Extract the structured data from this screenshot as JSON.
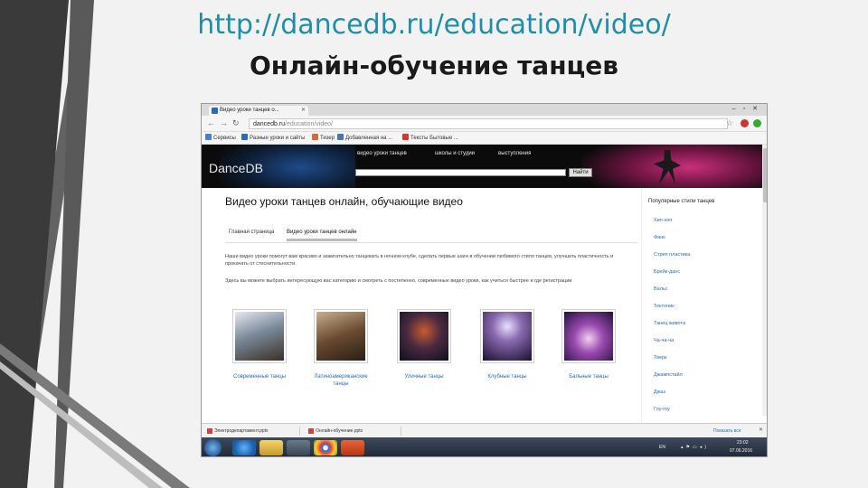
{
  "slide": {
    "url": "http://dancedb.ru/education/video/",
    "title": "Онлайн-обучение танцев"
  },
  "browser": {
    "tab_title": "Видео уроки танцев о...",
    "url_host": "dancedb.ru",
    "url_path": "/education/video/",
    "bookmarks": [
      "Сервисы",
      "Разные уроки и сайты",
      "Тизер",
      "Добавленная на ...",
      "Тексты Бытовые ..."
    ]
  },
  "site": {
    "logo": "DanceDB",
    "nav": [
      "видео уроки танцев",
      "школы и студии",
      "выступления"
    ],
    "search_button": "Найти"
  },
  "main": {
    "heading": "Видео уроки танцев онлайн, обучающие видео",
    "tabs": [
      "Главная страница",
      "Видео уроки танцев онлайн"
    ],
    "paragraph1": "Наши видео уроки помогут вам красиво и зажигательно танцевать в ночном клубе, сделать первые шаги в обучении любимого стиля танцев, улучшить пластичность и прокачать от стеснительности.",
    "paragraph2": "Здесь вы можете выбрать интересующую вас категорию и смотреть с постепенно, современные видео уроки, как учиться быстрее и где регистрации",
    "categories": [
      {
        "label": "Современные танцы"
      },
      {
        "label": "Латиноамериканские танцы"
      },
      {
        "label": "Уличные танцы"
      },
      {
        "label": "Клубные танцы"
      },
      {
        "label": "Бальные танцы"
      }
    ]
  },
  "sidebar": {
    "title": "Популярные стили танцев",
    "items": [
      "Хип-хоп",
      "Фанк",
      "Стрип пластика",
      "Брейк-данс",
      "Вальс",
      "Тектоник",
      "Танец живота",
      "Ча-ча-ча",
      "Тверк",
      "Джампстайл",
      "Джаз",
      "Гоу-гоу"
    ]
  },
  "downloads": {
    "items": [
      "Электродепартамент.pptx",
      "Онлайн-обучение.pptx"
    ],
    "show_all": "Показать все"
  },
  "taskbar": {
    "lang": "EN",
    "time": "23:02",
    "date": "07.06.2016"
  }
}
